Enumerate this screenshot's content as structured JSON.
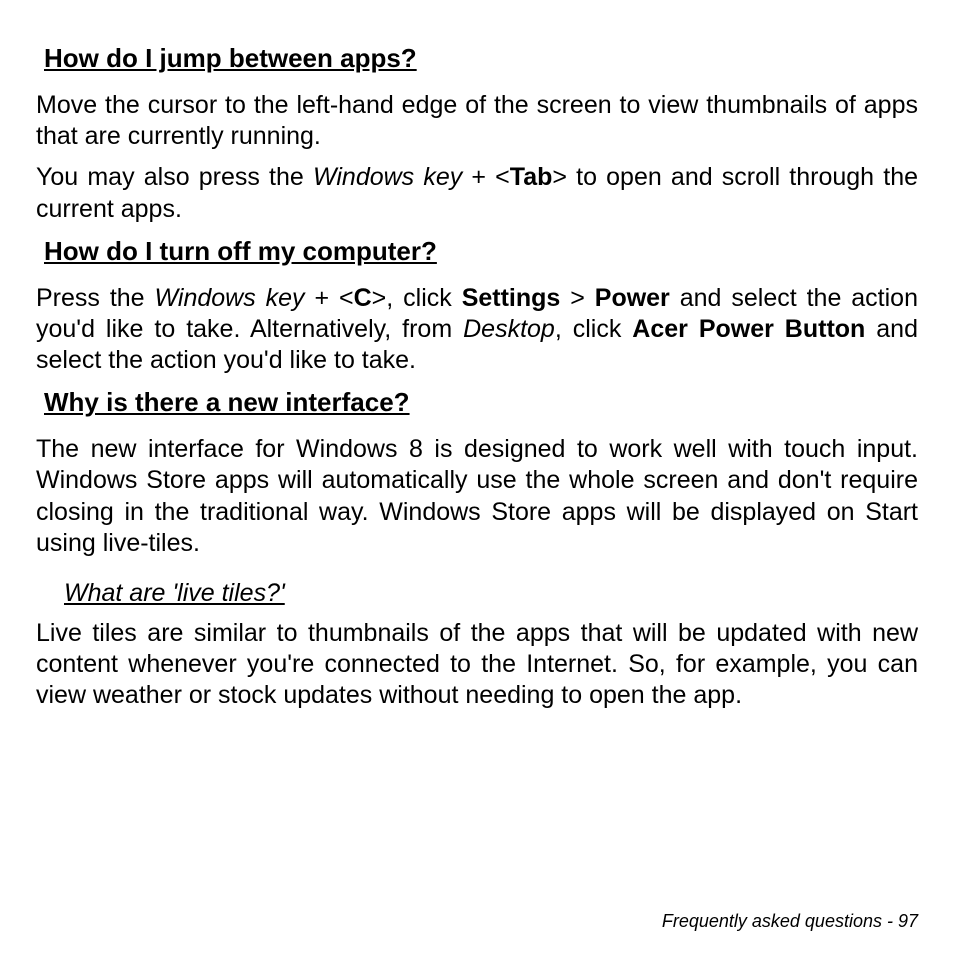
{
  "sections": {
    "s1": {
      "heading": "How do I jump between apps?",
      "p1": "Move the cursor to the left-hand edge of the screen to view thumbnails of apps that are currently running.",
      "p2a": "You may also press the ",
      "p2_winkey": "Windows key",
      "p2b": " + <",
      "p2_tab": "Tab",
      "p2c": "> to open and scroll through the current apps."
    },
    "s2": {
      "heading": "How do I turn off my computer?",
      "p1a": "Press the ",
      "p1_winkey": "Windows key",
      "p1b": " + <",
      "p1_c": "C",
      "p1c": ">, click ",
      "p1_settings": "Settings",
      "p1d": " > ",
      "p1_power": "Power",
      "p1e": " and select the action you'd like to take. Alternatively, from ",
      "p1_desktop": "Desktop",
      "p1f": ", click ",
      "p1_acer": "Acer Power Button",
      "p1g": " and select the action you'd like to take."
    },
    "s3": {
      "heading": "Why is there a new interface?",
      "p1": "The new interface for Windows 8 is designed to work well with touch input. Windows Store apps will automatically use the whole screen and don't require closing in the traditional way. Windows Store apps will be displayed on Start using live-tiles.",
      "sub_heading": "What are 'live tiles?'",
      "p2": "Live tiles are similar to thumbnails of the apps that will be updated with new content whenever you're connected to the Internet. So, for example, you can view weather or stock updates without needing to open the app."
    }
  },
  "footer": {
    "text": "Frequently asked questions -  97"
  }
}
